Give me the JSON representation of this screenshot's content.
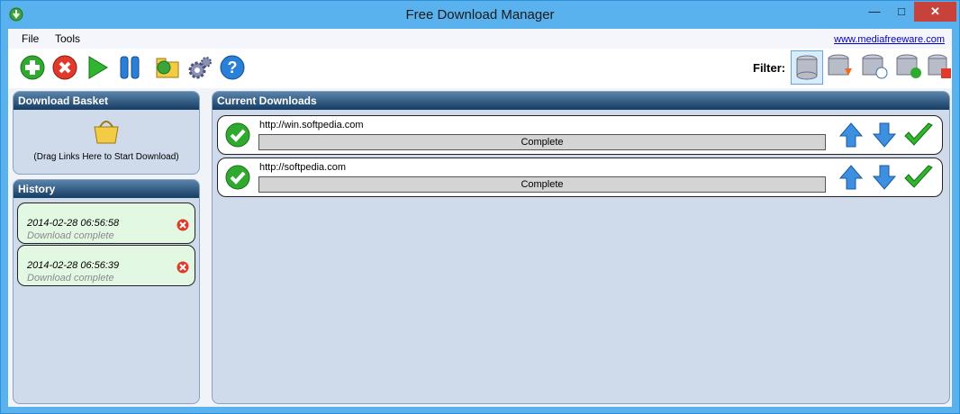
{
  "window": {
    "title": "Free Download Manager"
  },
  "menu": {
    "file": "File",
    "tools": "Tools",
    "link": "www.mediafreeware.com"
  },
  "toolbar": {
    "filter_label": "Filter:"
  },
  "basket": {
    "title": "Download Basket",
    "hint": "(Drag Links Here to Start Download)"
  },
  "history": {
    "title": "History",
    "items": [
      {
        "date": "2014-02-28 06:56:58",
        "status": "Download complete"
      },
      {
        "date": "2014-02-28 06:56:39",
        "status": "Download complete"
      }
    ]
  },
  "downloads": {
    "title": "Current Downloads",
    "items": [
      {
        "url": "http://win.softpedia.com",
        "status": "Complete",
        "progress": 1.0
      },
      {
        "url": "http://softpedia.com",
        "status": "Complete",
        "progress": 1.0
      }
    ]
  },
  "colors": {
    "titlebar": "#59b1ee",
    "panel_header": "#163c62",
    "panel_body": "#cfdbea",
    "history_item": "#e3f8e3",
    "close": "#c7423a"
  }
}
